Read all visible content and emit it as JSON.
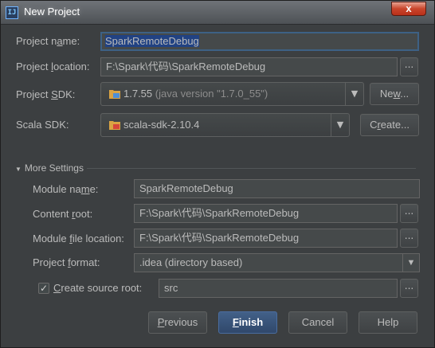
{
  "window": {
    "title": "New Project",
    "close_label": "x"
  },
  "form": {
    "project_name": {
      "label_pre": "Project n",
      "label_u": "a",
      "label_post": "me:",
      "value": "SparkRemoteDebug"
    },
    "project_location": {
      "label_pre": "Project ",
      "label_u": "l",
      "label_post": "ocation:",
      "value": "F:\\Spark\\代码\\SparkRemoteDebug",
      "browse_label": "..."
    },
    "project_sdk": {
      "label_pre": "Project ",
      "label_u": "S",
      "label_post": "DK:",
      "version": "1.7.55",
      "detail": "(java version \"1.7.0_55\")",
      "new_button_pre": "Ne",
      "new_button_u": "w",
      "new_button_post": "..."
    },
    "scala_sdk": {
      "label": "Scala SDK:",
      "value": "scala-sdk-2.10.4",
      "create_button_pre": "C",
      "create_button_u": "r",
      "create_button_post": "eate..."
    }
  },
  "more_settings": {
    "header": "More Settings",
    "module_name": {
      "label_pre": "Module na",
      "label_u": "m",
      "label_post": "e:",
      "value": "SparkRemoteDebug"
    },
    "content_root": {
      "label_pre": "Content ",
      "label_u": "r",
      "label_post": "oot:",
      "value": "F:\\Spark\\代码\\SparkRemoteDebug",
      "browse_label": "..."
    },
    "module_file_location": {
      "label_pre": "Module ",
      "label_u": "f",
      "label_post": "ile location:",
      "value": "F:\\Spark\\代码\\SparkRemoteDebug",
      "browse_label": "..."
    },
    "project_format": {
      "label_pre": "Project ",
      "label_u": "f",
      "label_post": "ormat:",
      "value": ".idea (directory based)"
    },
    "create_source_root": {
      "checked": true,
      "label_pre": "",
      "label_u": "C",
      "label_post": "reate source root:",
      "value": "src",
      "browse_label": "..."
    }
  },
  "buttons": {
    "previous_u": "P",
    "previous_post": "revious",
    "finish_u": "F",
    "finish_post": "inish",
    "cancel": "Cancel",
    "help": "Help"
  },
  "icons": {
    "sdk": "folder-java-icon",
    "scala": "folder-scala-icon",
    "dropdown": "chevron-down-icon"
  }
}
